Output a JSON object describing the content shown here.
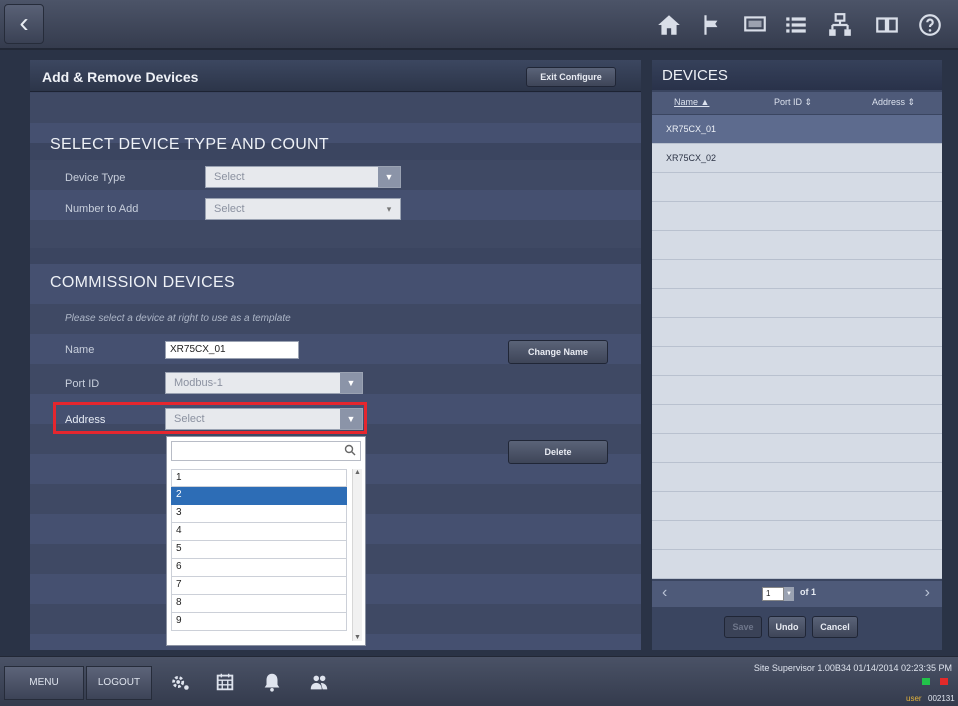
{
  "topbar": {
    "back_icon": "chevron-left-icon",
    "icons": [
      "home-icon",
      "flag-icon",
      "display-icon",
      "list-icon",
      "network-icon",
      "book-icon",
      "help-icon"
    ]
  },
  "left_panel": {
    "title": "Add & Remove Devices",
    "exit_button": "Exit Configure",
    "select_section": {
      "title": "SELECT DEVICE TYPE AND COUNT",
      "device_type_label": "Device Type",
      "device_type_value": "Select",
      "number_label": "Number to Add",
      "number_value": "Select"
    },
    "commission_section": {
      "title": "COMMISSION DEVICES",
      "hint": "Please select a device at right to use as a template",
      "name_label": "Name",
      "name_value": "XR75CX_01",
      "change_name_button": "Change Name",
      "port_label": "Port ID",
      "port_value": "Modbus-1",
      "address_label": "Address",
      "address_value": "Select",
      "delete_button": "Delete"
    },
    "address_dropdown": {
      "search_value": "",
      "options": [
        "1",
        "2",
        "3",
        "4",
        "5",
        "6",
        "7",
        "8",
        "9"
      ],
      "selected": "2"
    }
  },
  "right_panel": {
    "title": "DEVICES",
    "columns": [
      "Name",
      "Port ID",
      "Address"
    ],
    "rows": [
      {
        "name": "XR75CX_01"
      },
      {
        "name": "XR75CX_02"
      },
      {
        "name": ""
      },
      {
        "name": ""
      },
      {
        "name": ""
      },
      {
        "name": ""
      },
      {
        "name": ""
      },
      {
        "name": ""
      },
      {
        "name": ""
      },
      {
        "name": ""
      },
      {
        "name": ""
      },
      {
        "name": ""
      },
      {
        "name": ""
      },
      {
        "name": ""
      },
      {
        "name": ""
      },
      {
        "name": ""
      }
    ],
    "pager": {
      "page": "1",
      "of_label": "of 1"
    },
    "save_button": "Save",
    "undo_button": "Undo",
    "cancel_button": "Cancel"
  },
  "bottom_bar": {
    "menu_button": "MENU",
    "logout_button": "LOGOUT",
    "icons": [
      "settings-icon",
      "calendar-icon",
      "alarm-bell-icon",
      "users-icon"
    ],
    "status_text": "Site Supervisor 1.00B34 01/14/2014 02:23:35 PM",
    "user_label": "user",
    "user_id": "002131"
  }
}
